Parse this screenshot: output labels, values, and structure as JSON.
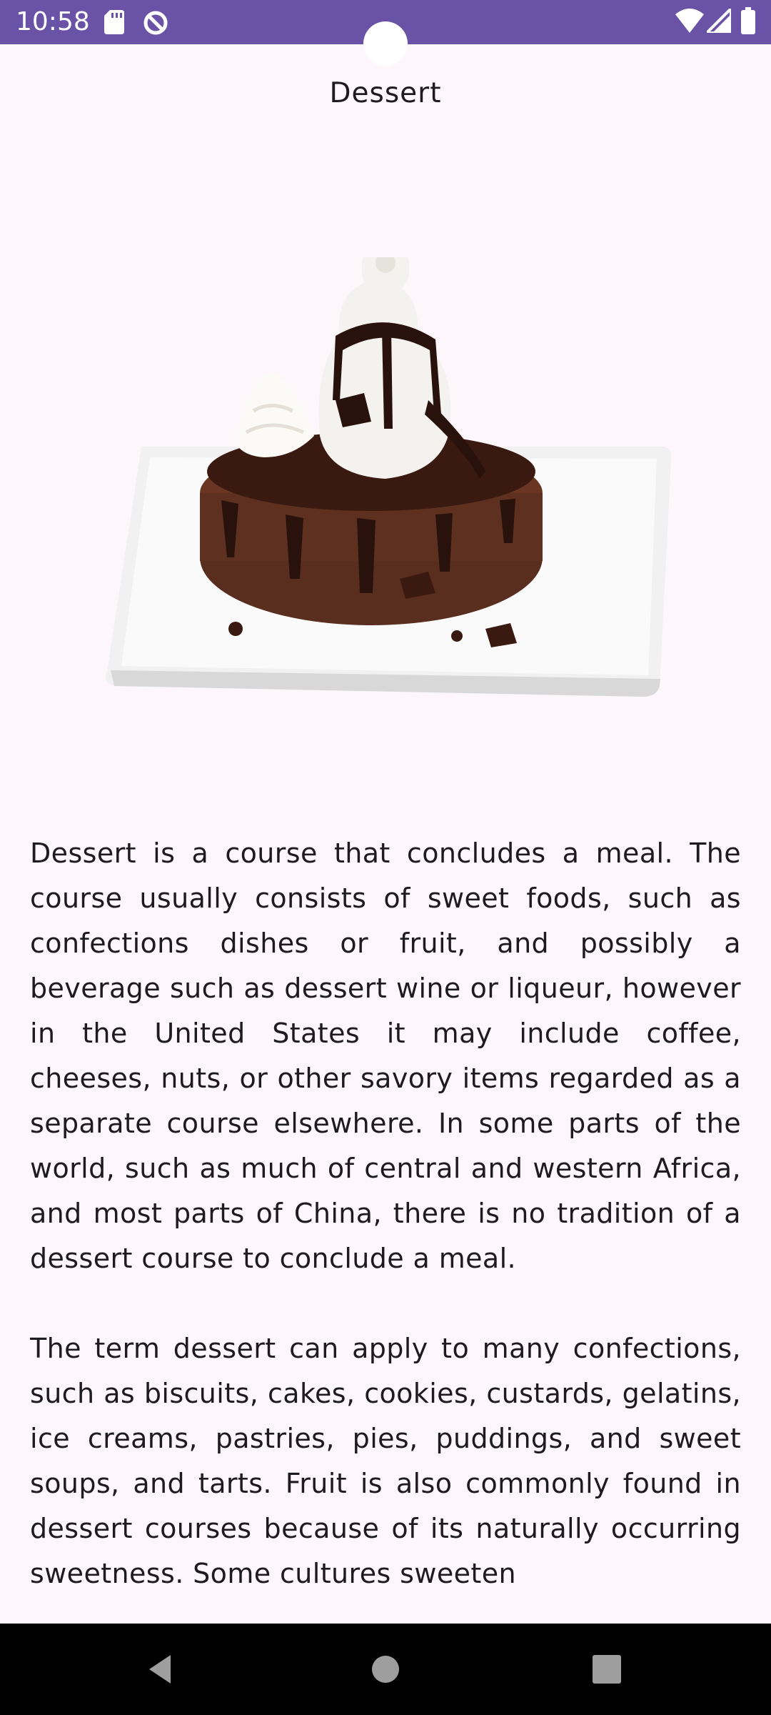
{
  "status_bar": {
    "time": "10:58",
    "icons": [
      "sd-card-icon",
      "data-saver-icon",
      "wifi-icon",
      "cell-signal-icon",
      "battery-icon"
    ],
    "background": "#6a52a6"
  },
  "header": {
    "title": "Dessert"
  },
  "hero": {
    "image": "chocolate-lava-cake-with-soft-serve-icon"
  },
  "article": {
    "paragraph_1": "Dessert is a course that concludes a meal. The course usually consists of sweet foods, such as confections dishes or fruit, and possibly a beverage such as dessert wine or liqueur, however in the United States it may include coffee, cheeses, nuts, or other savory items regarded as a separate course elsewhere. In some parts of the world, such as much of central and western Africa, and most parts of China, there is no tradition of a dessert course to conclude a meal.",
    "paragraph_2": "The term dessert can apply to many confections, such as biscuits, cakes, cookies, custards, gelatins, ice creams, pastries, pies, puddings, and sweet soups, and tarts. Fruit is also commonly found in dessert courses because of its naturally occurring sweetness. Some cultures sweeten"
  },
  "nav_bar": {
    "buttons": [
      "back-icon",
      "home-icon",
      "recents-icon"
    ]
  }
}
